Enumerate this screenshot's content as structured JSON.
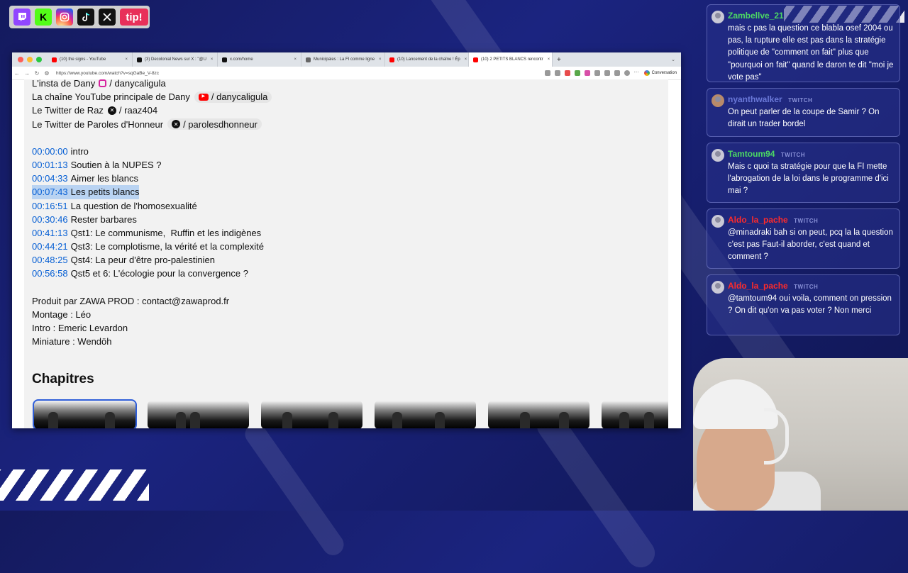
{
  "social_bar": {
    "icons": [
      "twitch-icon",
      "kick-icon",
      "instagram-icon",
      "tiktok-icon",
      "x-icon"
    ],
    "kick_letter": "K",
    "tip_label": "tip!"
  },
  "browser": {
    "tabs": [
      {
        "title": "(10) the signs - YouTube",
        "fav_color": "#ff0000"
      },
      {
        "title": "(3) Decolonial News sur X : \"@U",
        "fav_color": "#111111"
      },
      {
        "title": "x.com/home",
        "fav_color": "#111111"
      },
      {
        "title": "Municipales : La FI comme ligne",
        "fav_color": "#666666"
      },
      {
        "title": "(10) Lancement de la chaîne ! Ép",
        "fav_color": "#ff0000"
      },
      {
        "title": "(10) 2 PETITS BLANCS rencontr",
        "fav_color": "#ff0000"
      }
    ],
    "new_tab": "+",
    "url": "https://www.youtube.com/watch?v=sqGaBe_V-8zc",
    "conversation_label": "Conversation"
  },
  "description": {
    "links": [
      {
        "text": "L'insta de Dany",
        "handle": "/ danycaligula",
        "icon": "instagram-icon"
      },
      {
        "text": "La chaîne YouTube principale de Dany",
        "handle": "/ danycaligula",
        "icon": "youtube-icon"
      },
      {
        "text": "Le Twitter de Raz",
        "handle": "/ raaz404",
        "icon": "x-icon"
      },
      {
        "text": "Le Twitter de Paroles d'Honneur",
        "handle": "/ parolesdhonneur",
        "icon": "x-icon"
      }
    ],
    "timestamps": [
      {
        "time": "00:00:00",
        "label": "intro"
      },
      {
        "time": "00:01:13",
        "label": "Soutien à la NUPES ?"
      },
      {
        "time": "00:04:33",
        "label": "Aimer les blancs"
      },
      {
        "time": "00:07:43",
        "label": "Les petits blancs",
        "highlighted": true
      },
      {
        "time": "00:16:51",
        "label": "La question de l'homosexualité"
      },
      {
        "time": "00:30:46",
        "label": "Rester barbares"
      },
      {
        "time": "00:41:13",
        "label": "Qst1: Le communisme,  Ruffin et les indigènes"
      },
      {
        "time": "00:44:21",
        "label": "Qst3: Le complotisme, la vérité et la complexité"
      },
      {
        "time": "00:48:25",
        "label": "Qst4: La peur d'être pro-palestinien"
      },
      {
        "time": "00:56:58",
        "label": "Qst5 et 6: L'écologie pour la convergence ?"
      }
    ],
    "credits": [
      "Produit par ZAWA PROD : contact@zawaprod.fr",
      "Montage : Léo",
      "Intro : Emeric Levardon",
      "Miniature : Wendöh"
    ],
    "chapters_title": "Chapitres"
  },
  "chat": {
    "messages": [
      {
        "user": "Zambellve_21",
        "user_color": "#4cd964",
        "badge": "",
        "text": "mais c pas la question ce blabla osef 2004 ou pas, la rupture elle est pas dans la stratégie politique de \"comment on fait\" plus que \"pourquoi on fait\" quand le daron te dit \"moi je vote pas\""
      },
      {
        "user": "nyanthwalker",
        "user_color": "#6a78d8",
        "badge": "TWITCH",
        "text": "On peut parler de la coupe de Samir ? On dirait un trader bordel"
      },
      {
        "user": "Tamtoum94",
        "user_color": "#4cd964",
        "badge": "TWITCH",
        "text": "Mais c quoi ta stratégie pour que la FI mette l'abrogation de la loi dans le programme d'ici mai ?"
      },
      {
        "user": "Aldo_la_pache",
        "user_color": "#ff2a2a",
        "badge": "TWITCH",
        "text": "@minadraki bah si on peut, pcq la la question c'est pas Faut-il aborder, c'est quand et comment ?"
      },
      {
        "user": "Aldo_la_pache",
        "user_color": "#ff2a2a",
        "badge": "TWITCH",
        "text": "@tamtoum94 oui voila, comment on pression ? On dit qu'on va pas voter ? Non merci"
      }
    ]
  }
}
